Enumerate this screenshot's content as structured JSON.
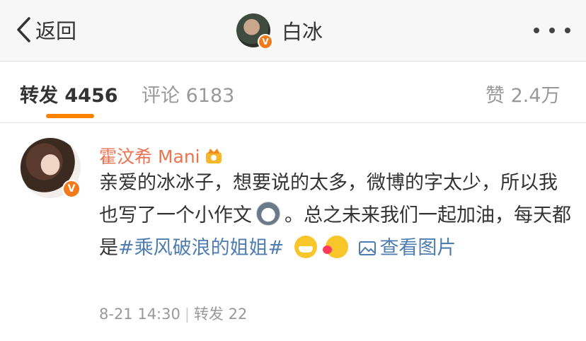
{
  "navbar": {
    "back_label": "返回",
    "title": "白冰",
    "verified_badge": "V"
  },
  "tabs": {
    "repost": "转发 4456",
    "comment": "评论 6183",
    "like": "赞 2.4万",
    "active": "repost",
    "accent_color": "#ff8200"
  },
  "post": {
    "author": "霍汶希 Mani",
    "verified_badge": "V",
    "text_part1": "亲爱的冰冰子，想要说的太多，微博的字太少，所以我也写了一个小作文",
    "text_part2": "。总之未来我们一起加油，每天都是",
    "hashtag": "#乘风破浪的姐姐#",
    "view_picture_label": "查看图片",
    "date": "8-21 14:30",
    "separator": "|",
    "repost_count": "转发 22",
    "colors": {
      "author": "#eb7350",
      "link": "#507daf"
    }
  },
  "icons": [
    "back-chevron-icon",
    "more-dots-icon",
    "crown-icon",
    "husky-emoji-icon",
    "grin-emoji-icon",
    "kiss-emoji-icon",
    "picture-icon"
  ]
}
